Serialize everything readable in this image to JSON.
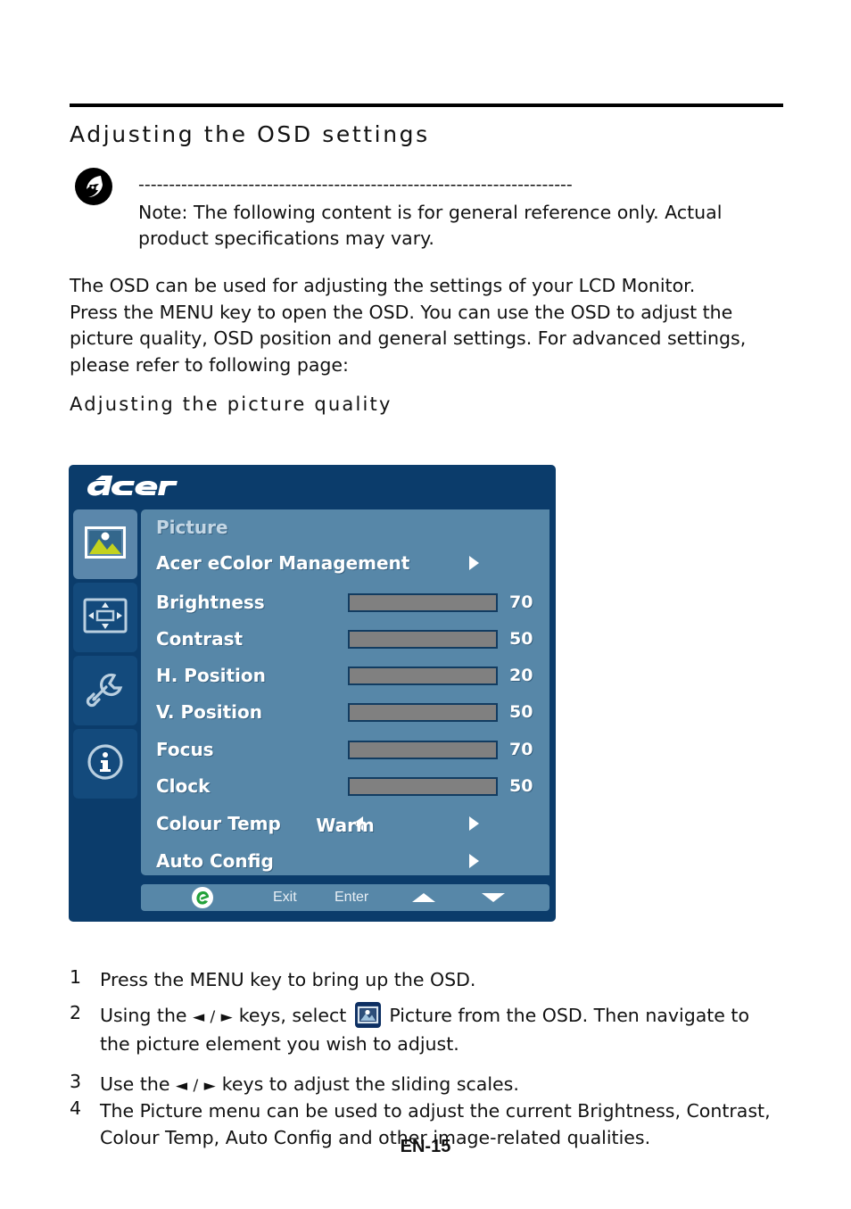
{
  "document": {
    "section_heading": "Adjusting  the  OSD  settings",
    "subsection_heading": "Adjusting  the  picture  quality",
    "page_number": "EN-15"
  },
  "note": {
    "icon": "acer-note-icon",
    "divider": "-----------------------------------------------------------------------",
    "line1": "Note: The following content is for general reference only. Actual",
    "line2": "product specifications may vary."
  },
  "intro": {
    "line1": "The OSD can be used for adjusting the settings of your LCD Monitor.",
    "line2": "Press the MENU key to open the OSD. You can use the OSD to adjust the",
    "line3": "picture quality, OSD position and general settings. For advanced settings,",
    "line4": "please refer to following page:"
  },
  "osd": {
    "brand": "acer",
    "sidebar": [
      {
        "name": "picture-icon",
        "active": true
      },
      {
        "name": "position-icon",
        "active": false
      },
      {
        "name": "setting-icon",
        "active": false
      },
      {
        "name": "information-icon",
        "active": false
      }
    ],
    "title": "Picture",
    "rows": [
      {
        "label": "Acer eColor Management",
        "type": "submenu"
      },
      {
        "label": "Brightness",
        "type": "slider",
        "value": 70
      },
      {
        "label": "Contrast",
        "type": "slider",
        "value": 50
      },
      {
        "label": "H. Position",
        "type": "slider",
        "value": 20
      },
      {
        "label": "V. Position",
        "type": "slider",
        "value": 50
      },
      {
        "label": "Focus",
        "type": "slider",
        "value": 70
      },
      {
        "label": "Clock",
        "type": "slider",
        "value": 50
      },
      {
        "label": "Colour Temp",
        "type": "option",
        "value": "Warm"
      },
      {
        "label": "Auto Config",
        "type": "submenu"
      }
    ],
    "footer": {
      "logo": "acer-e-logo",
      "exit": "Exit",
      "enter": "Enter",
      "up": "up-arrow-icon",
      "down": "down-arrow-icon"
    },
    "colors": {
      "frame": "#0b3c6b",
      "panel": "#5787a8",
      "sidebar_active": "#5b87ab",
      "sidebar_inactive": "#134a7c",
      "slider_track": "#808080",
      "slider_fill": "#b6d7f3",
      "slider_border": "#123c61"
    }
  },
  "steps": [
    {
      "num": "1",
      "text": "Press the MENU key to bring up the OSD."
    },
    {
      "num": "2",
      "pre": "Using the ",
      "keys": "◄ / ►",
      "mid": " keys, select ",
      "post": " Picture from the OSD. Then navigate to",
      "line2": "the picture element you wish to adjust."
    },
    {
      "num": "3",
      "pre": "Use the ",
      "keys": "◄ / ►",
      "post": " keys to adjust the sliding scales."
    },
    {
      "num": "4",
      "line1": "The Picture menu can be used to adjust the current Brightness, Contrast,",
      "line2": "Colour Temp, Auto Config and other image-related qualities."
    }
  ]
}
